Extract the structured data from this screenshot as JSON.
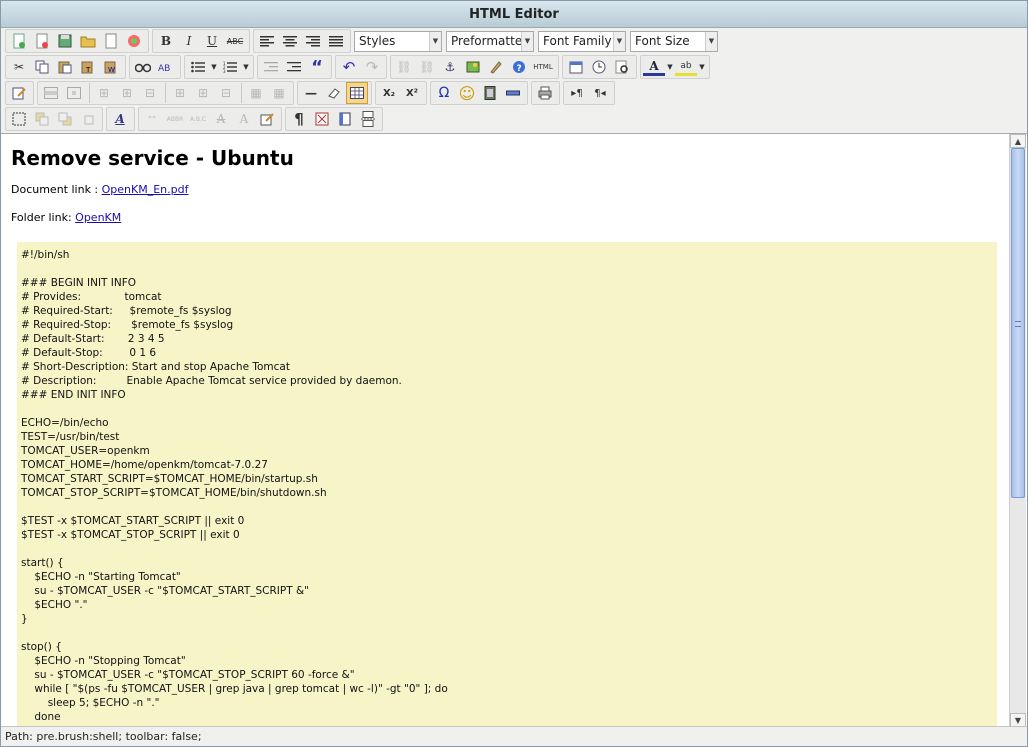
{
  "window": {
    "title": "HTML Editor"
  },
  "toolbar": {
    "styles_value": "Styles",
    "format_value": "Preformatted",
    "font_family_value": "Font Family",
    "font_size_value": "Font Size"
  },
  "document": {
    "title": "Remove service - Ubuntu",
    "document_link_label": "Document link : ",
    "document_link_text": "OpenKM_En.pdf",
    "folder_link_label": "Folder link: ",
    "folder_link_text": "OpenKM",
    "code": "#!/bin/sh\n\n### BEGIN INIT INFO\n# Provides:             tomcat\n# Required-Start:     $remote_fs $syslog\n# Required-Stop:      $remote_fs $syslog\n# Default-Start:       2 3 4 5\n# Default-Stop:        0 1 6\n# Short-Description: Start and stop Apache Tomcat\n# Description:         Enable Apache Tomcat service provided by daemon.\n### END INIT INFO\n\nECHO=/bin/echo\nTEST=/usr/bin/test\nTOMCAT_USER=openkm\nTOMCAT_HOME=/home/openkm/tomcat-7.0.27\nTOMCAT_START_SCRIPT=$TOMCAT_HOME/bin/startup.sh\nTOMCAT_STOP_SCRIPT=$TOMCAT_HOME/bin/shutdown.sh\n\n$TEST -x $TOMCAT_START_SCRIPT || exit 0\n$TEST -x $TOMCAT_STOP_SCRIPT || exit 0\n\nstart() {\n    $ECHO -n \"Starting Tomcat\"\n    su - $TOMCAT_USER -c \"$TOMCAT_START_SCRIPT &\"\n    $ECHO \".\"\n}\n\nstop() {\n    $ECHO -n \"Stopping Tomcat\"\n    su - $TOMCAT_USER -c \"$TOMCAT_STOP_SCRIPT 60 -force &\"\n    while [ \"$(ps -fu $TOMCAT_USER | grep java | grep tomcat | wc -l)\" -gt \"0\" ]; do\n        sleep 5; $ECHO -n \".\"\n    done"
  },
  "statusbar": {
    "path": "Path: pre.brush:shell; toolbar: false;"
  },
  "icons": {
    "bold": "B",
    "italic": "I",
    "underline": "U",
    "strike": "ABC",
    "subscript": "X₂",
    "superscript": "X²",
    "omega": "Ω",
    "smiley": "☺",
    "pilcrow": "¶",
    "hr": "—",
    "undo": "↶",
    "redo": "↷",
    "quote": "“",
    "anchor": "⚓",
    "help": "?",
    "html": "HTML",
    "find": "🔍"
  }
}
